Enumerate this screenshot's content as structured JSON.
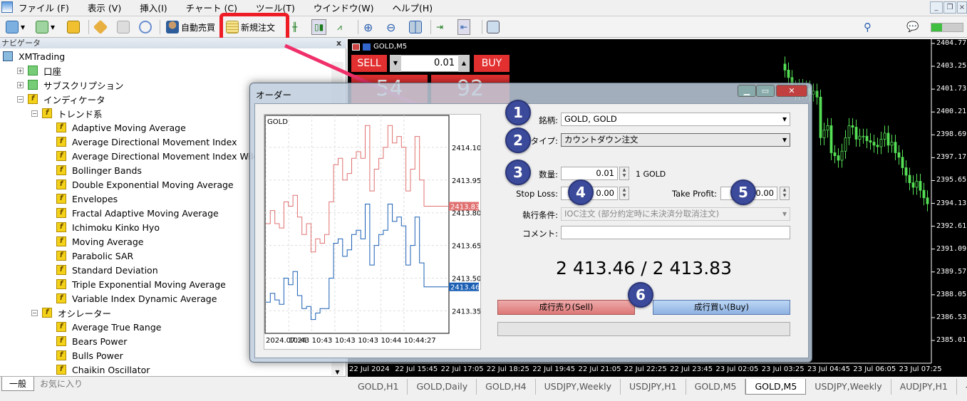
{
  "menu": [
    "ファイル (F)",
    "表示 (V)",
    "挿入(I)",
    "チャート (C)",
    "ツール(T)",
    "ウインドウ(W)",
    "ヘルプ(H)"
  ],
  "toolbar": {
    "auto_trade": "自動売買",
    "new_order": "新規注文"
  },
  "navigator": {
    "title": "ナビゲータ",
    "close": "x",
    "tabs": [
      "一般",
      "お気に入り"
    ],
    "items": [
      {
        "label": "XMTrading",
        "level": 0,
        "icon": "computer-icon"
      },
      {
        "label": "口座",
        "level": 1,
        "icon": "accounts-icon",
        "expander": "+"
      },
      {
        "label": "サブスクリプション",
        "level": 1,
        "icon": "subscription-icon",
        "expander": "+"
      },
      {
        "label": "インディケータ",
        "level": 1,
        "icon": "indicator-icon",
        "expander": "-"
      },
      {
        "label": "トレンド系",
        "level": 2,
        "icon": "indicator-icon",
        "expander": "-"
      },
      {
        "label": "Adaptive Moving Average",
        "level": 3,
        "icon": "indicator-icon"
      },
      {
        "label": "Average Directional Movement Index",
        "level": 3,
        "icon": "indicator-icon"
      },
      {
        "label": "Average Directional Movement Index Wilder",
        "level": 3,
        "icon": "indicator-icon"
      },
      {
        "label": "Bollinger Bands",
        "level": 3,
        "icon": "indicator-icon"
      },
      {
        "label": "Double Exponential Moving Average",
        "level": 3,
        "icon": "indicator-icon"
      },
      {
        "label": "Envelopes",
        "level": 3,
        "icon": "indicator-icon"
      },
      {
        "label": "Fractal Adaptive Moving Average",
        "level": 3,
        "icon": "indicator-icon"
      },
      {
        "label": "Ichimoku Kinko Hyo",
        "level": 3,
        "icon": "indicator-icon"
      },
      {
        "label": "Moving Average",
        "level": 3,
        "icon": "indicator-icon"
      },
      {
        "label": "Parabolic SAR",
        "level": 3,
        "icon": "indicator-icon"
      },
      {
        "label": "Standard Deviation",
        "level": 3,
        "icon": "indicator-icon"
      },
      {
        "label": "Triple Exponential Moving Average",
        "level": 3,
        "icon": "indicator-icon"
      },
      {
        "label": "Variable Index Dynamic Average",
        "level": 3,
        "icon": "indicator-icon"
      },
      {
        "label": "オシレーター",
        "level": 2,
        "icon": "indicator-icon",
        "expander": "-"
      },
      {
        "label": "Average True Range",
        "level": 3,
        "icon": "indicator-icon"
      },
      {
        "label": "Bears Power",
        "level": 3,
        "icon": "indicator-icon"
      },
      {
        "label": "Bulls Power",
        "level": 3,
        "icon": "indicator-icon"
      },
      {
        "label": "Chaikin Oscillator",
        "level": 3,
        "icon": "indicator-icon"
      }
    ]
  },
  "chart": {
    "title": "GOLD,M5",
    "sell": "SELL",
    "buy": "BUY",
    "lot": "0.01",
    "sell_digits": "54",
    "buy_digits": "92",
    "price_labels": [
      "2404.77",
      "2403.25",
      "2401.73",
      "2400.21",
      "2398.69",
      "2397.17",
      "2395.65",
      "2394.13",
      "2392.61",
      "2391.09",
      "2389.57",
      "2388.05",
      "2386.53",
      "2385.01"
    ],
    "price_range": [
      2385.01,
      2404.77
    ],
    "time_labels": [
      "22 Jul 2024",
      "22 Jul 15:45",
      "22 Jul 17:05",
      "22 Jul 18:25",
      "22 Jul 19:45",
      "22 Jul 21:05",
      "22 Jul 22:25",
      "22 Jul 23:45",
      "23 Jul 02:05",
      "23 Jul 03:25",
      "23 Jul 04:45",
      "23 Jul 06:05",
      "23 Jul 07:25"
    ],
    "candle_color": "#55e055",
    "visible_closes": [
      2403.0,
      2402.5,
      2401.8,
      2401.5,
      2401.9,
      2401.6,
      2401.8,
      2401.4,
      2401.6,
      2401.2,
      2398.5,
      2399.0,
      2399.3,
      2397.5,
      2397.3,
      2397.0,
      2397.6,
      2398.5,
      2399.3,
      2399.2,
      2398.4,
      2398.6,
      2398.6,
      2398.3,
      2398.2,
      2398.0,
      2397.9,
      2398.4,
      2398.8,
      2398.0,
      2398.2,
      2397.5,
      2397.2,
      2396.5,
      2396.0,
      2395.5,
      2395.2,
      2395.6,
      2395.0,
      2394.5,
      2394.1
    ]
  },
  "chart_tabs": {
    "items": [
      "GOLD,H1",
      "GOLD,Daily",
      "GOLD,H4",
      "USDJPY,Weekly",
      "USDJPY,H1",
      "GOLD,M5",
      "GOLD,M5",
      "USDJPY,Weekly",
      "AUDJPY,H1"
    ],
    "active": 6
  },
  "order": {
    "title": "オーダー",
    "symbol_label": "銘柄:",
    "symbol": "GOLD, GOLD",
    "type_label": "タイプ:",
    "type": "カウントダウン注文",
    "volume_label": "数量:",
    "volume": "0.01",
    "volume_unit": "1 GOLD",
    "sl_label": "Stop Loss:",
    "sl": "0.00",
    "tp_label": "Take Profit:",
    "tp": "0.00",
    "fill_label": "執行条件:",
    "fill": "IOC注文 (部分約定時に未決済分取消注文)",
    "comment_label": "コメント:",
    "comment": "",
    "prices": "2 413.46 / 2 413.83",
    "sell_button": "成行売り(Sell)",
    "buy_button": "成行買い(Buy)",
    "steps": [
      "1",
      "2",
      "3",
      "4",
      "5",
      "6"
    ],
    "mini_chart": {
      "symbol": "GOLD",
      "y_labels": [
        "2414.10",
        "2413.95",
        "2413.80",
        "2413.65",
        "2413.50",
        "2413.35"
      ],
      "y_range": [
        2413.25,
        2414.25
      ],
      "x_labels": [
        "2024.07.24",
        "10:43",
        "10:43",
        "10:43",
        "10:43",
        "10:44",
        "10:44:27"
      ],
      "ask_label": "2413.83",
      "bid_label": "2413.46",
      "ask_color": "#e07070",
      "bid_color": "#1a5fb4",
      "ask": [
        2413.75,
        2413.81,
        2413.75,
        2413.73,
        2413.85,
        2413.83,
        2413.88,
        2413.78,
        2413.7,
        2413.75,
        2413.62,
        2413.68,
        2413.66,
        2413.7,
        2413.85,
        2414.02,
        2414.05,
        2413.95,
        2413.98,
        2414.05,
        2414.08,
        2414.05,
        2414.2,
        2413.9,
        2414.0,
        2414.05,
        2414.1,
        2414.2,
        2414.12,
        2414.15,
        2414.1,
        2413.9,
        2414.0,
        2414.15,
        2413.95,
        2413.83,
        2413.83
      ],
      "bid": [
        2413.39,
        2413.43,
        2413.4,
        2413.38,
        2413.5,
        2413.47,
        2413.53,
        2413.42,
        2413.36,
        2413.37,
        2413.31,
        2413.34,
        2413.36,
        2413.36,
        2413.5,
        2413.66,
        2413.68,
        2413.6,
        2413.63,
        2413.7,
        2413.72,
        2413.68,
        2413.84,
        2413.56,
        2413.65,
        2413.7,
        2413.72,
        2413.84,
        2413.76,
        2413.78,
        2413.74,
        2413.56,
        2413.65,
        2413.78,
        2413.57,
        2413.46,
        2413.46
      ]
    }
  }
}
